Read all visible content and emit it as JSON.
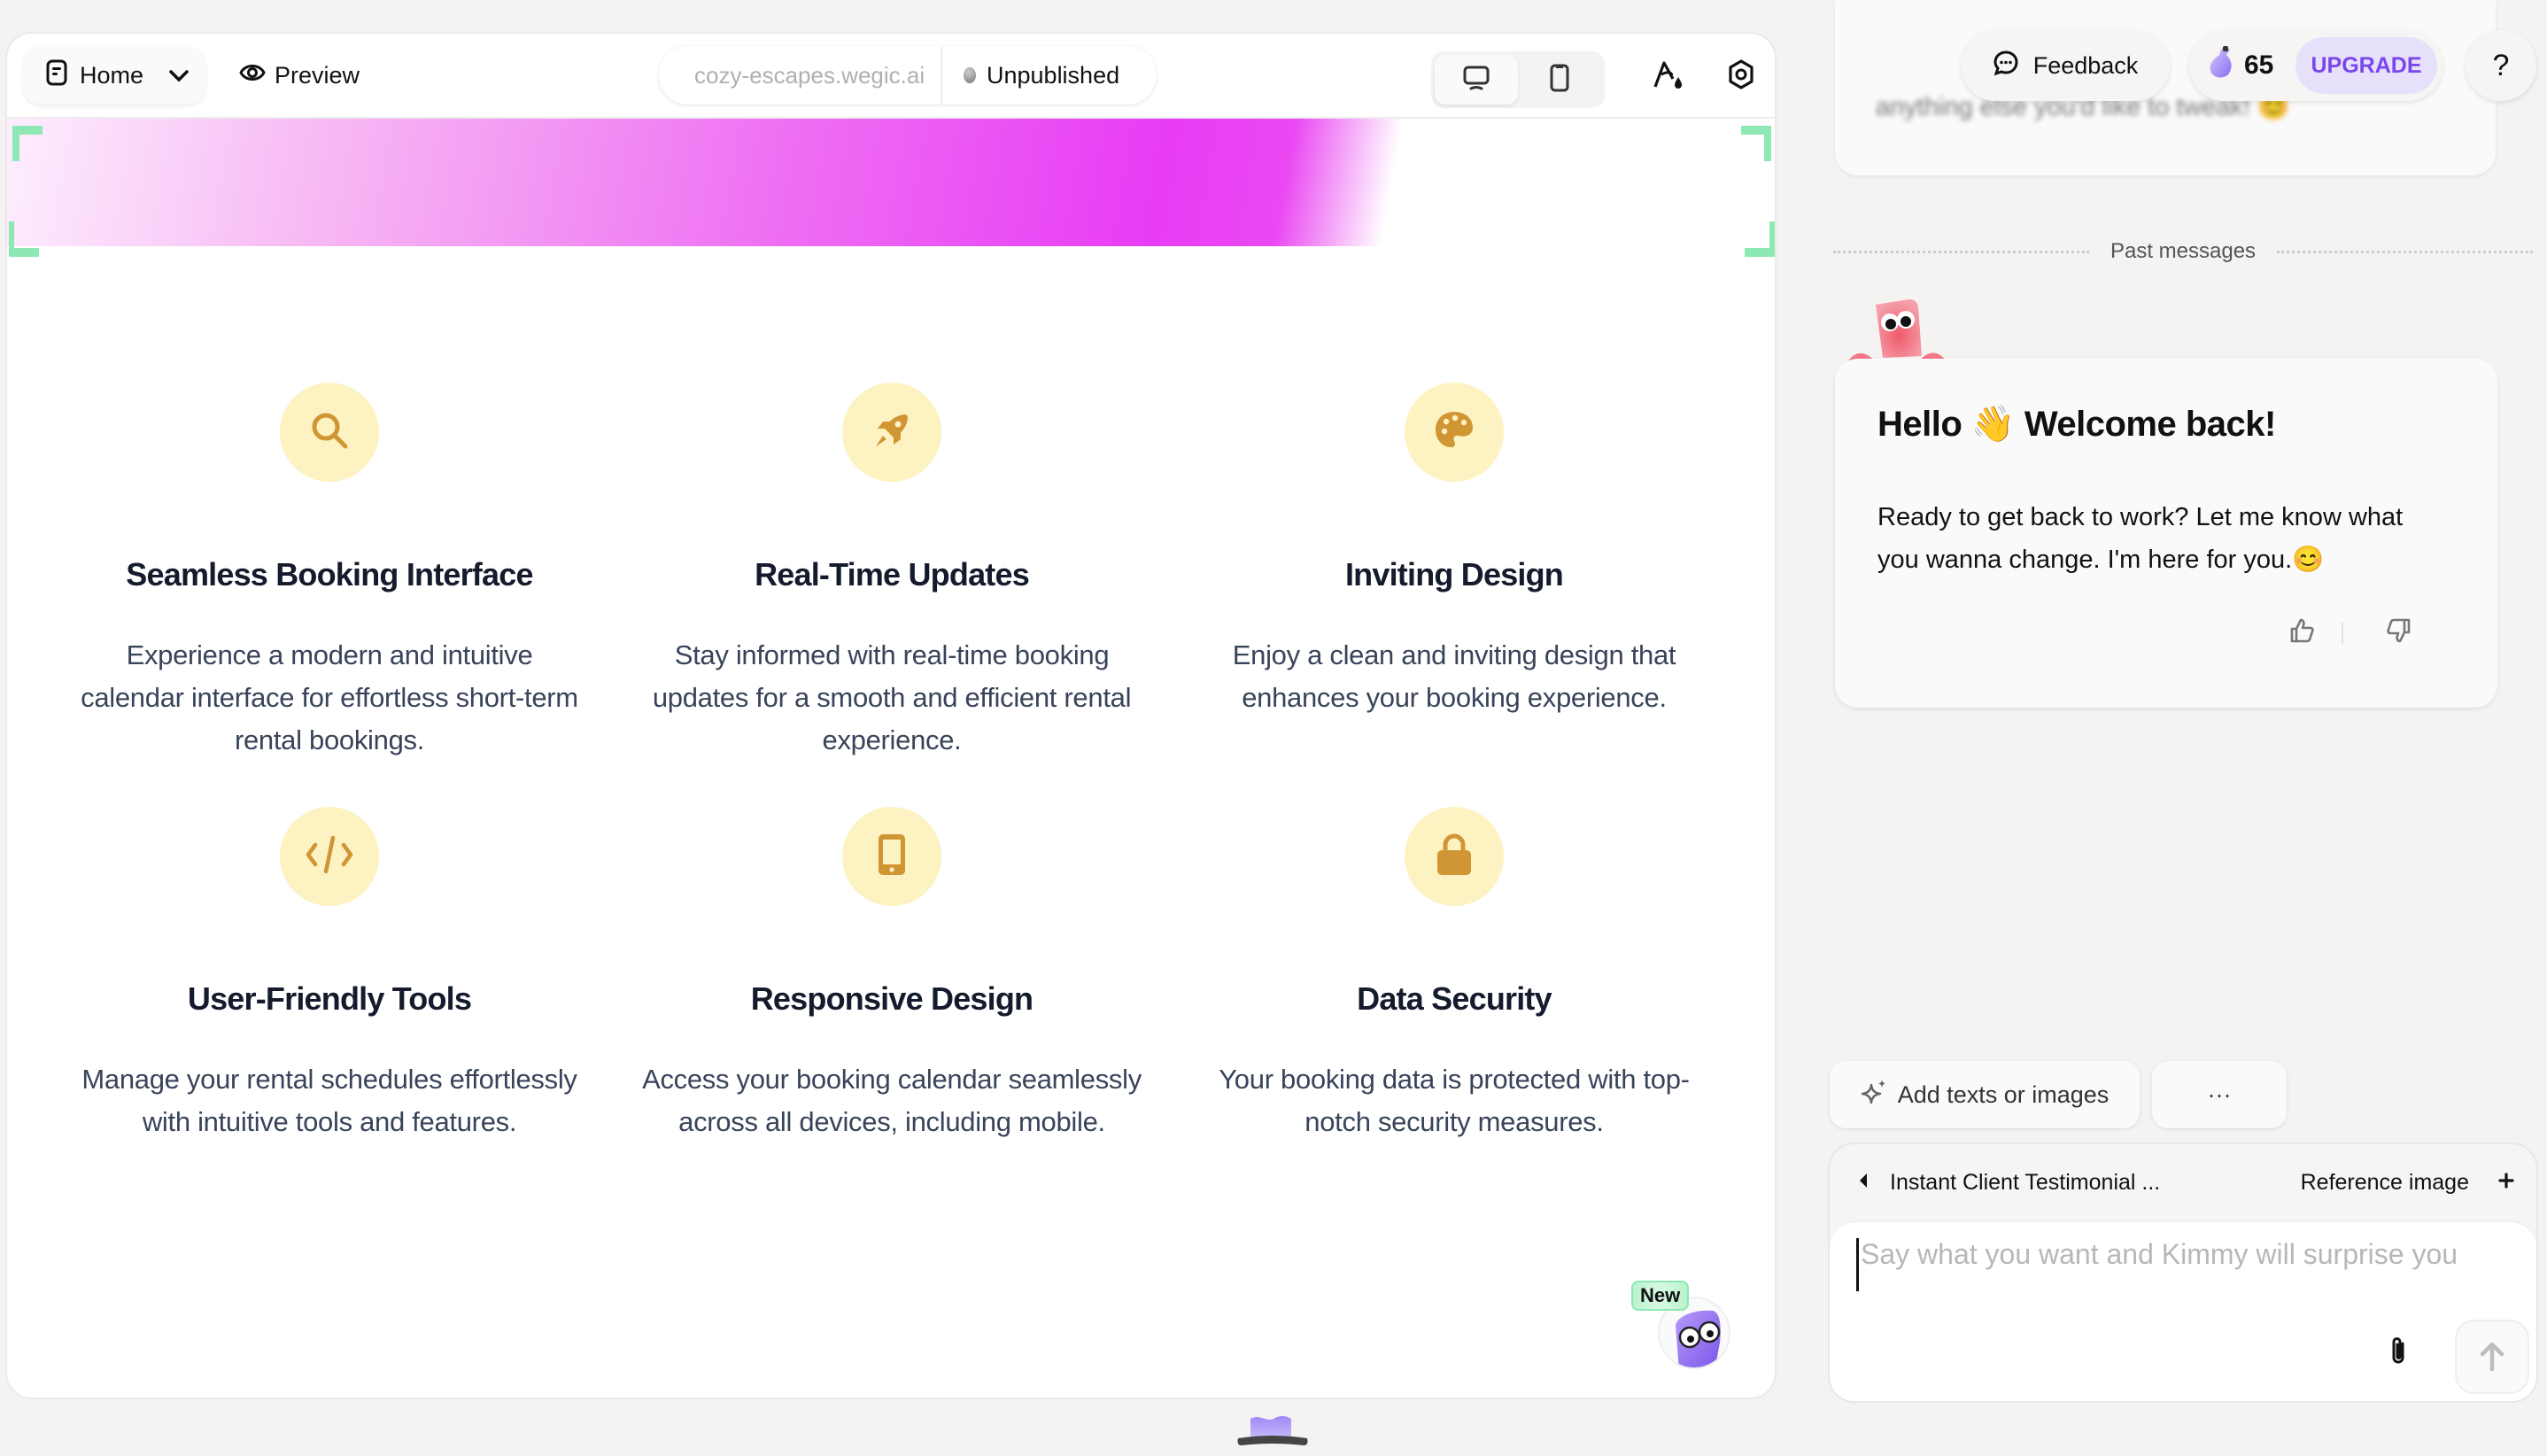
{
  "toolbar": {
    "page_selector": "Home",
    "preview_label": "Preview",
    "site_url": "cozy-escapes.wegic.ai",
    "publish_status": "Unpublished",
    "devices": [
      {
        "name": "desktop",
        "active": true
      },
      {
        "name": "mobile",
        "active": false
      }
    ]
  },
  "features": [
    {
      "icon": "search-icon",
      "title": "Seamless Booking Interface",
      "description": "Experience a modern and intuitive calendar interface for effortless short-term rental bookings."
    },
    {
      "icon": "rocket-icon",
      "title": "Real-Time Updates",
      "description": "Stay informed with real-time booking updates for a smooth and efficient rental experience."
    },
    {
      "icon": "palette-icon",
      "title": "Inviting Design",
      "description": "Enjoy a clean and inviting design that enhances your booking experience."
    },
    {
      "icon": "code-icon",
      "title": "User-Friendly Tools",
      "description": "Manage your rental schedules effortlessly with intuitive tools and features."
    },
    {
      "icon": "mobile-icon",
      "title": "Responsive Design",
      "description": "Access your booking calendar seamlessly across all devices, including mobile."
    },
    {
      "icon": "lock-icon",
      "title": "Data Security",
      "description": "Your booking data is protected with top-notch security measures."
    }
  ],
  "kimmy_badge": {
    "tag": "New"
  },
  "header": {
    "feedback_label": "Feedback",
    "credits": "65",
    "upgrade_label": "UPGRADE",
    "help_label": "?"
  },
  "chat": {
    "previous_message_fragment": "anything else you'd like to tweak! 😊",
    "past_messages_label": "Past messages",
    "welcome_title": "Hello 👋 Welcome back!",
    "welcome_body": "Ready to get back to work? Let me know what you wanna change. I'm here for you.😊",
    "add_chip_label": "Add texts or images",
    "more_chip_label": "···",
    "reference_title": "Instant Client Testimonial ...",
    "reference_image_label": "Reference image",
    "input_placeholder": "Say what you want and Kimmy will surprise you",
    "input_value": ""
  },
  "colors": {
    "icon_bg": "#fdf2c1",
    "icon_fg": "#d19634",
    "banner_accent": "#e83cf4",
    "selection_bracket": "#8de8b4",
    "upgrade_bg": "#e6e0fb",
    "upgrade_fg": "#7b45ec"
  }
}
